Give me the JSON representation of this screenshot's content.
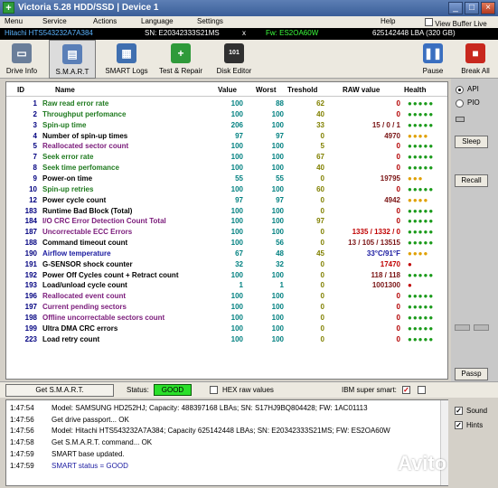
{
  "window": {
    "title": "Victoria 5.28 HDD/SSD | Device 1",
    "app_icon": "+"
  },
  "menu": [
    "Menu",
    "Service",
    "Actions",
    "Language",
    "Settings",
    "Help",
    "View Buffer Live"
  ],
  "info": {
    "model": "Hitachi HTS543232A7A384",
    "sn": "SN: E20342333S21MS",
    "x": "x",
    "fw": "Fw: ES2OA60W",
    "lba": "625142448 LBA (320 GB)"
  },
  "toolbar": {
    "drive_info": "Drive Info",
    "smart": "S.M.A.R.T",
    "smart_logs": "SMART Logs",
    "test_repair": "Test & Repair",
    "disk_editor": "Disk Editor",
    "pause": "Pause",
    "break_all": "Break All"
  },
  "table": {
    "headers": {
      "id": "ID",
      "name": "Name",
      "value": "Value",
      "worst": "Worst",
      "treshold": "Treshold",
      "raw": "RAW value",
      "health": "Health"
    },
    "rows": [
      {
        "id": "1",
        "name": "Raw read error rate",
        "value": "100",
        "worst": "88",
        "tres": "62",
        "raw": "0",
        "health": "●●●●●",
        "nc": "#1f7a1f",
        "hc": "#1a9a1a",
        "rc": "#b30000"
      },
      {
        "id": "2",
        "name": "Throughput perfomance",
        "value": "100",
        "worst": "100",
        "tres": "40",
        "raw": "0",
        "health": "●●●●●",
        "nc": "#1f7a1f",
        "hc": "#1a9a1a",
        "rc": "#b30000"
      },
      {
        "id": "3",
        "name": "Spin-up time",
        "value": "206",
        "worst": "100",
        "tres": "33",
        "raw": "15 / 0 / 1",
        "health": "●●●●●",
        "nc": "#1f7a1f",
        "hc": "#1a9a1a",
        "rc": "#7a1414"
      },
      {
        "id": "4",
        "name": "Number of spin-up times",
        "value": "97",
        "worst": "97",
        "tres": "0",
        "raw": "4970",
        "health": "●●●●",
        "nc": "#000000",
        "hc": "#e0a000",
        "rc": "#7a1414"
      },
      {
        "id": "5",
        "name": "Reallocated sector count",
        "value": "100",
        "worst": "100",
        "tres": "5",
        "raw": "0",
        "health": "●●●●●",
        "nc": "#7a1a7a",
        "hc": "#1a9a1a",
        "rc": "#b30000"
      },
      {
        "id": "7",
        "name": "Seek error rate",
        "value": "100",
        "worst": "100",
        "tres": "67",
        "raw": "0",
        "health": "●●●●●",
        "nc": "#1f7a1f",
        "hc": "#1a9a1a",
        "rc": "#b30000"
      },
      {
        "id": "8",
        "name": "Seek time perfomance",
        "value": "100",
        "worst": "100",
        "tres": "40",
        "raw": "0",
        "health": "●●●●●",
        "nc": "#1f7a1f",
        "hc": "#1a9a1a",
        "rc": "#b30000"
      },
      {
        "id": "9",
        "name": "Power-on time",
        "value": "55",
        "worst": "55",
        "tres": "0",
        "raw": "19795",
        "health": "●●●",
        "nc": "#000000",
        "hc": "#e0a000",
        "rc": "#7a1414"
      },
      {
        "id": "10",
        "name": "Spin-up retries",
        "value": "100",
        "worst": "100",
        "tres": "60",
        "raw": "0",
        "health": "●●●●●",
        "nc": "#1f7a1f",
        "hc": "#1a9a1a",
        "rc": "#b30000"
      },
      {
        "id": "12",
        "name": "Power cycle count",
        "value": "97",
        "worst": "97",
        "tres": "0",
        "raw": "4942",
        "health": "●●●●",
        "nc": "#000000",
        "hc": "#e0a000",
        "rc": "#7a1414"
      },
      {
        "id": "183",
        "name": "Runtime Bad Block (Total)",
        "value": "100",
        "worst": "100",
        "tres": "0",
        "raw": "0",
        "health": "●●●●●",
        "nc": "#000000",
        "hc": "#1a9a1a",
        "rc": "#b30000"
      },
      {
        "id": "184",
        "name": "I/O CRC Error Detection Count Total",
        "value": "100",
        "worst": "100",
        "tres": "97",
        "raw": "0",
        "health": "●●●●●",
        "nc": "#7a1a7a",
        "hc": "#1a9a1a",
        "rc": "#b30000"
      },
      {
        "id": "187",
        "name": "Uncorrectable ECC Errors",
        "value": "100",
        "worst": "100",
        "tres": "0",
        "raw": "1335 / 1332 / 0",
        "health": "●●●●●",
        "nc": "#7a1a7a",
        "hc": "#1a9a1a",
        "rc": "#c00000"
      },
      {
        "id": "188",
        "name": "Command timeout count",
        "value": "100",
        "worst": "56",
        "tres": "0",
        "raw": "13 / 105 / 13515",
        "health": "●●●●●",
        "nc": "#000000",
        "hc": "#1a9a1a",
        "rc": "#7a1414"
      },
      {
        "id": "190",
        "name": "Airflow temperature",
        "value": "67",
        "worst": "48",
        "tres": "45",
        "raw": "33°C/91°F",
        "health": "●●●●",
        "nc": "#1a1aa0",
        "hc": "#e0a000",
        "rc": "#1a1aa0"
      },
      {
        "id": "191",
        "name": "G-SENSOR shock counter",
        "value": "32",
        "worst": "32",
        "tres": "0",
        "raw": "17470",
        "health": "●",
        "nc": "#000000",
        "hc": "#c00000",
        "rc": "#c00000"
      },
      {
        "id": "192",
        "name": "Power Off Cycles count + Retract count",
        "value": "100",
        "worst": "100",
        "tres": "0",
        "raw": "118 / 118",
        "health": "●●●●●",
        "nc": "#000000",
        "hc": "#1a9a1a",
        "rc": "#7a1414"
      },
      {
        "id": "193",
        "name": "Load/unload cycle count",
        "value": "1",
        "worst": "1",
        "tres": "0",
        "raw": "1001300",
        "health": "●",
        "nc": "#000000",
        "hc": "#c00000",
        "rc": "#7a1414"
      },
      {
        "id": "196",
        "name": "Reallocated event count",
        "value": "100",
        "worst": "100",
        "tres": "0",
        "raw": "0",
        "health": "●●●●●",
        "nc": "#7a1a7a",
        "hc": "#1a9a1a",
        "rc": "#b30000"
      },
      {
        "id": "197",
        "name": "Current pending sectors",
        "value": "100",
        "worst": "100",
        "tres": "0",
        "raw": "0",
        "health": "●●●●●",
        "nc": "#7a1a7a",
        "hc": "#1a9a1a",
        "rc": "#b30000"
      },
      {
        "id": "198",
        "name": "Offline uncorrectable sectors count",
        "value": "100",
        "worst": "100",
        "tres": "0",
        "raw": "0",
        "health": "●●●●●",
        "nc": "#7a1a7a",
        "hc": "#1a9a1a",
        "rc": "#b30000"
      },
      {
        "id": "199",
        "name": "Ultra DMA CRC errors",
        "value": "100",
        "worst": "100",
        "tres": "0",
        "raw": "0",
        "health": "●●●●●",
        "nc": "#000000",
        "hc": "#1a9a1a",
        "rc": "#b30000"
      },
      {
        "id": "223",
        "name": "Load retry count",
        "value": "100",
        "worst": "100",
        "tres": "0",
        "raw": "0",
        "health": "●●●●●",
        "nc": "#000000",
        "hc": "#1a9a1a",
        "rc": "#b30000"
      }
    ]
  },
  "right": {
    "api": "API",
    "pio": "PIO",
    "sleep": "Sleep",
    "recall": "Recall",
    "passp": "Passp"
  },
  "status": {
    "get_smart": "Get S.M.A.R.T.",
    "status_label": "Status:",
    "status_value": "GOOD",
    "hex_raw": "HEX raw values",
    "ibm": "IBM super smart:"
  },
  "log": [
    {
      "time": "1:47:54",
      "msg": "Model: SAMSUNG HD252HJ; Capacity: 488397168 LBAs; SN: S17HJ9BQ804428; FW: 1AC01113",
      "color": "#000000"
    },
    {
      "time": "1:47:56",
      "msg": "Get drive passport... OK",
      "color": "#000000"
    },
    {
      "time": "1:47:56",
      "msg": "Model: Hitachi HTS543232A7A384; Capacity 625142448 LBAs; SN: E20342333S21MS; FW: ES2OA60W",
      "color": "#000000"
    },
    {
      "time": "1:47:58",
      "msg": "Get S.M.A.R.T. command... OK",
      "color": "#000000"
    },
    {
      "time": "1:47:59",
      "msg": "SMART base updated.",
      "color": "#000000"
    },
    {
      "time": "1:47:59",
      "msg": "SMART status = GOOD",
      "color": "#1a1aa0"
    }
  ],
  "side": {
    "sound": "Sound",
    "hints": "Hints"
  },
  "watermark": "Avito"
}
